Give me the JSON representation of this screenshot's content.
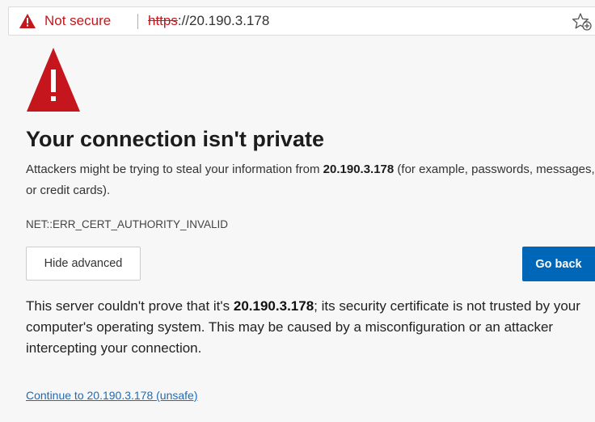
{
  "addressbar": {
    "security_label": "Not secure",
    "url_scheme": "https",
    "url_rest": "://20.190.3.178",
    "icons": [
      "warning-icon",
      "favorite-star-add-icon"
    ]
  },
  "page": {
    "icon": "warning-triangle-icon",
    "title": "Your connection isn't private",
    "desc_before": "Attackers might be trying to steal your information from ",
    "desc_host": "20.190.3.178",
    "desc_after": " (for example, passwords, messages, or credit cards).",
    "error_code": "NET::ERR_CERT_AUTHORITY_INVALID",
    "hide_advanced_label": "Hide advanced",
    "go_back_label": "Go back",
    "details_before": "This server couldn't prove that it's ",
    "details_host": "20.190.3.178",
    "details_after": "; its security certificate is not trusted by your computer's operating system. This may be caused by a misconfiguration or an attacker intercepting your connection.",
    "continue_link": "Continue to 20.190.3.178 (unsafe)"
  },
  "colors": {
    "danger": "#c4161c",
    "primary_button": "#0067b8",
    "link": "#1e6bb8",
    "background": "#f7f7f7"
  }
}
